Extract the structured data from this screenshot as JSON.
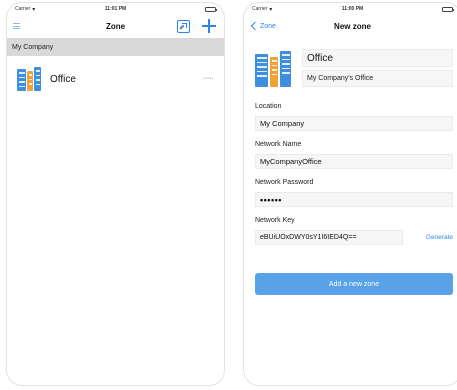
{
  "left": {
    "status": {
      "carrier": "Carrier",
      "time": "11:01 PM"
    },
    "nav": {
      "title": "Zone"
    },
    "section": "My Company",
    "zones": [
      {
        "label": "Office",
        "dots": "•••••"
      }
    ]
  },
  "right": {
    "status": {
      "carrier": "Carrier",
      "time": "11:00 PM"
    },
    "nav": {
      "back": "Zone",
      "title": "New zone"
    },
    "zone": {
      "name": "Office",
      "description": "My Company's Office"
    },
    "fields": {
      "location": {
        "label": "Location",
        "value": "My Company"
      },
      "network_name": {
        "label": "Network Name",
        "value": "MyCompanyOffice"
      },
      "network_password": {
        "label": "Network Password",
        "value": "••••••"
      },
      "network_key": {
        "label": "Network Key",
        "value": "eBUiUOxDWY0sY1I6IED4Q=="
      }
    },
    "generate_label": "Generate",
    "add_button": "Add a new zone"
  },
  "colors": {
    "accent": "#2f86e8",
    "button": "#5aa2e8",
    "section_bg": "#d9d9d9"
  }
}
